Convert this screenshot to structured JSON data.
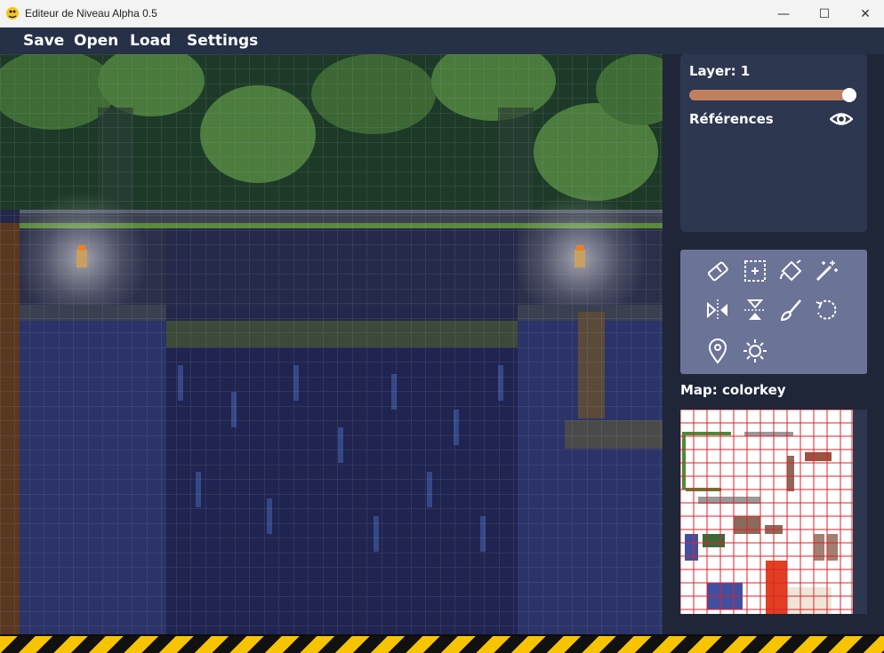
{
  "window": {
    "title": "Editeur de Niveau Alpha 0.5",
    "controls": {
      "minimize": "—",
      "maximize": "☐",
      "close": "✕"
    }
  },
  "menu": {
    "items": [
      {
        "id": "save",
        "label": "Save"
      },
      {
        "id": "open",
        "label": "Open"
      },
      {
        "id": "load",
        "label": "Load"
      },
      {
        "id": "settings",
        "label": "Settings"
      }
    ]
  },
  "sidebar": {
    "layer_label": "Layer: 1",
    "layer_slider_fraction": 1.0,
    "references_label": "Références",
    "references_icon": "eye-icon",
    "tools": [
      {
        "name": "eraser-tool",
        "icon": "eraser-icon"
      },
      {
        "name": "selection-tool",
        "icon": "selection-box-icon"
      },
      {
        "name": "fill-tool",
        "icon": "fill-bucket-icon"
      },
      {
        "name": "magic-wand-tool",
        "icon": "magic-wand-icon"
      },
      {
        "name": "flip-horizontal-tool",
        "icon": "flip-horizontal-icon"
      },
      {
        "name": "flip-vertical-tool",
        "icon": "flip-vertical-icon"
      },
      {
        "name": "brush-tool",
        "icon": "brush-icon"
      },
      {
        "name": "rotate-tool",
        "icon": "rotate-icon"
      },
      {
        "name": "location-tool",
        "icon": "location-pin-icon"
      },
      {
        "name": "light-tool",
        "icon": "sun-icon"
      }
    ],
    "map_label": "Map: colorkey"
  },
  "colors": {
    "menubar": "#263047",
    "panel": "#2e3750",
    "tools_panel": "#6b7396",
    "slider": "#c08060",
    "minimap_grid": "#e0202a",
    "hazard_yellow": "#f6c400"
  }
}
